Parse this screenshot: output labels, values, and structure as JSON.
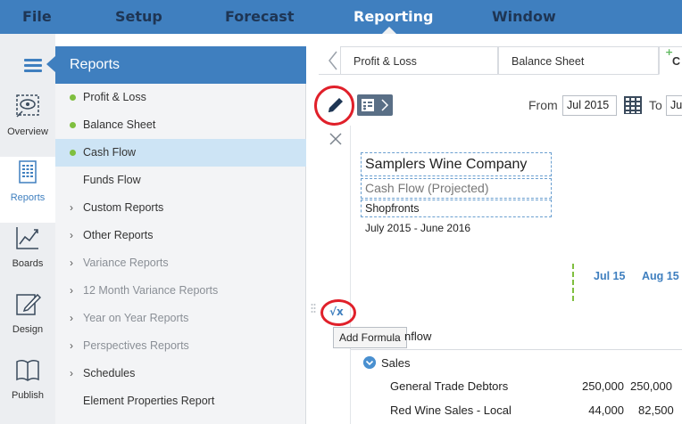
{
  "menu": {
    "items": [
      "File",
      "Setup",
      "Forecast",
      "Reporting",
      "Window"
    ],
    "active": "Reporting"
  },
  "leftnav": {
    "items": [
      "Overview",
      "Reports",
      "Boards",
      "Design",
      "Publish"
    ],
    "active": "Reports"
  },
  "reports": {
    "title": "Reports",
    "items": [
      {
        "label": "Profit & Loss",
        "marker": "dot"
      },
      {
        "label": "Balance Sheet",
        "marker": "dot"
      },
      {
        "label": "Cash Flow",
        "marker": "dot",
        "selected": true
      },
      {
        "label": "Funds Flow",
        "marker": "none"
      },
      {
        "label": "Custom Reports",
        "marker": "chevron"
      },
      {
        "label": "Other Reports",
        "marker": "chevron"
      },
      {
        "label": "Variance Reports",
        "marker": "chevron",
        "dim": true
      },
      {
        "label": "12 Month Variance Reports",
        "marker": "chevron",
        "dim": true
      },
      {
        "label": "Year on Year Reports",
        "marker": "chevron",
        "dim": true
      },
      {
        "label": "Perspectives Reports",
        "marker": "chevron",
        "dim": true
      },
      {
        "label": "Schedules",
        "marker": "chevron"
      },
      {
        "label": "Element Properties Report",
        "marker": "none"
      }
    ]
  },
  "tabs": {
    "items": [
      "Profit & Loss",
      "Balance Sheet",
      "C"
    ]
  },
  "toolbar": {
    "from_label": "From",
    "from_value": "Jul 2015",
    "to_label": "To",
    "to_value": "Ju"
  },
  "report": {
    "company": "Samplers Wine Company",
    "title": "Cash Flow (Projected)",
    "scope": "Shopfronts",
    "period": "July 2015 - June 2016",
    "columns": [
      "Jul 15",
      "Aug 15"
    ],
    "tooltip": "Add Formula",
    "tooltip_tail": "nflow",
    "section": "Sales",
    "rows": [
      {
        "label": "General Trade Debtors",
        "values": [
          "250,000",
          "250,000"
        ]
      },
      {
        "label": "Red Wine Sales - Local",
        "values": [
          "44,000",
          "82,500"
        ]
      }
    ]
  },
  "colors": {
    "brand_blue": "#3f7fbf",
    "highlight_red": "#e0202a",
    "status_green": "#7fbf3f",
    "selected_row": "#cde4f5"
  }
}
